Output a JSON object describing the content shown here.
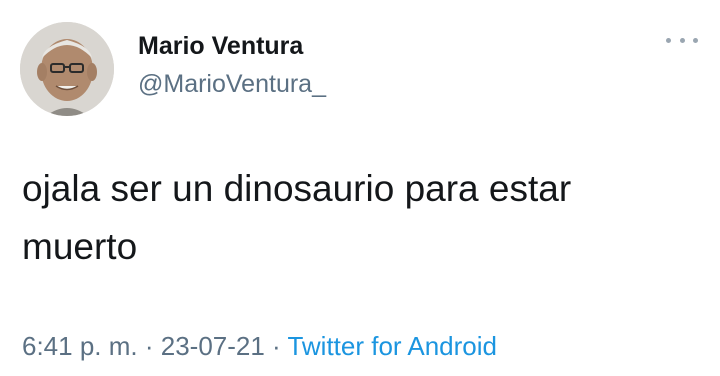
{
  "author": {
    "name": "Mario Ventura",
    "handle": "@MarioVentura_"
  },
  "tweet": {
    "text": "ojala ser un dinosaurio para estar\nmuerto"
  },
  "meta": {
    "time": "6:41 p. m.",
    "separator_1": " · ",
    "date": "23-07-21",
    "separator_2": " · ",
    "source": "Twitter for Android"
  },
  "icons": {
    "more": "more-options-icon"
  },
  "colors": {
    "name": "#14171a",
    "secondary": "#5b7083",
    "link": "#1b95e0",
    "background": "#ffffff"
  }
}
